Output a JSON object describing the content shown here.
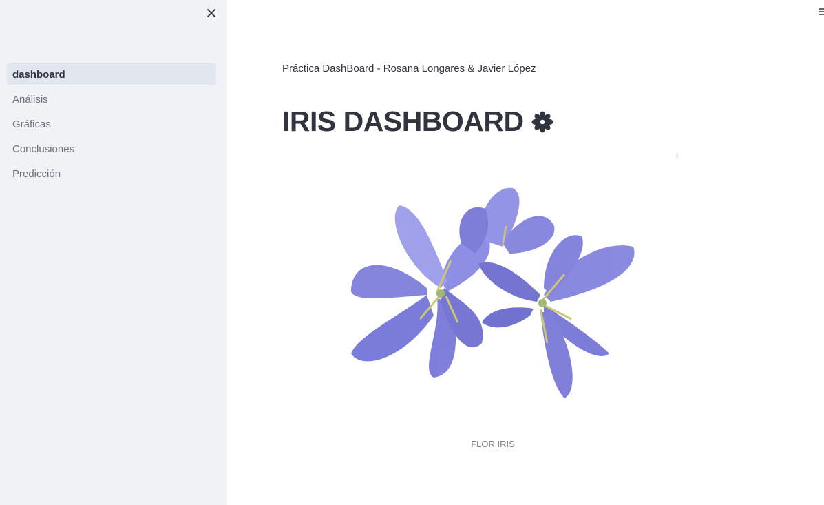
{
  "sidebar": {
    "items": [
      {
        "label": "dashboard",
        "active": true
      },
      {
        "label": "Análisis",
        "active": false
      },
      {
        "label": "Gráficas",
        "active": false
      },
      {
        "label": "Conclusiones",
        "active": false
      },
      {
        "label": "Predicción",
        "active": false
      }
    ],
    "close_icon": "close-icon"
  },
  "header": {
    "menu_icon": "hamburger-menu-icon"
  },
  "main": {
    "subtitle": "Práctica DashBoard - Rosana Longares & Javier López",
    "title": "IRIS DASHBOARD",
    "title_icon": "blossom-icon",
    "image_caption": "FLOR IRIS"
  },
  "colors": {
    "sidebar_bg": "#f0f2f6",
    "active_item_bg": "#e2e6ee",
    "text": "#31333f",
    "muted_text": "#6b6f7b",
    "petal": "#7f7fe0"
  }
}
